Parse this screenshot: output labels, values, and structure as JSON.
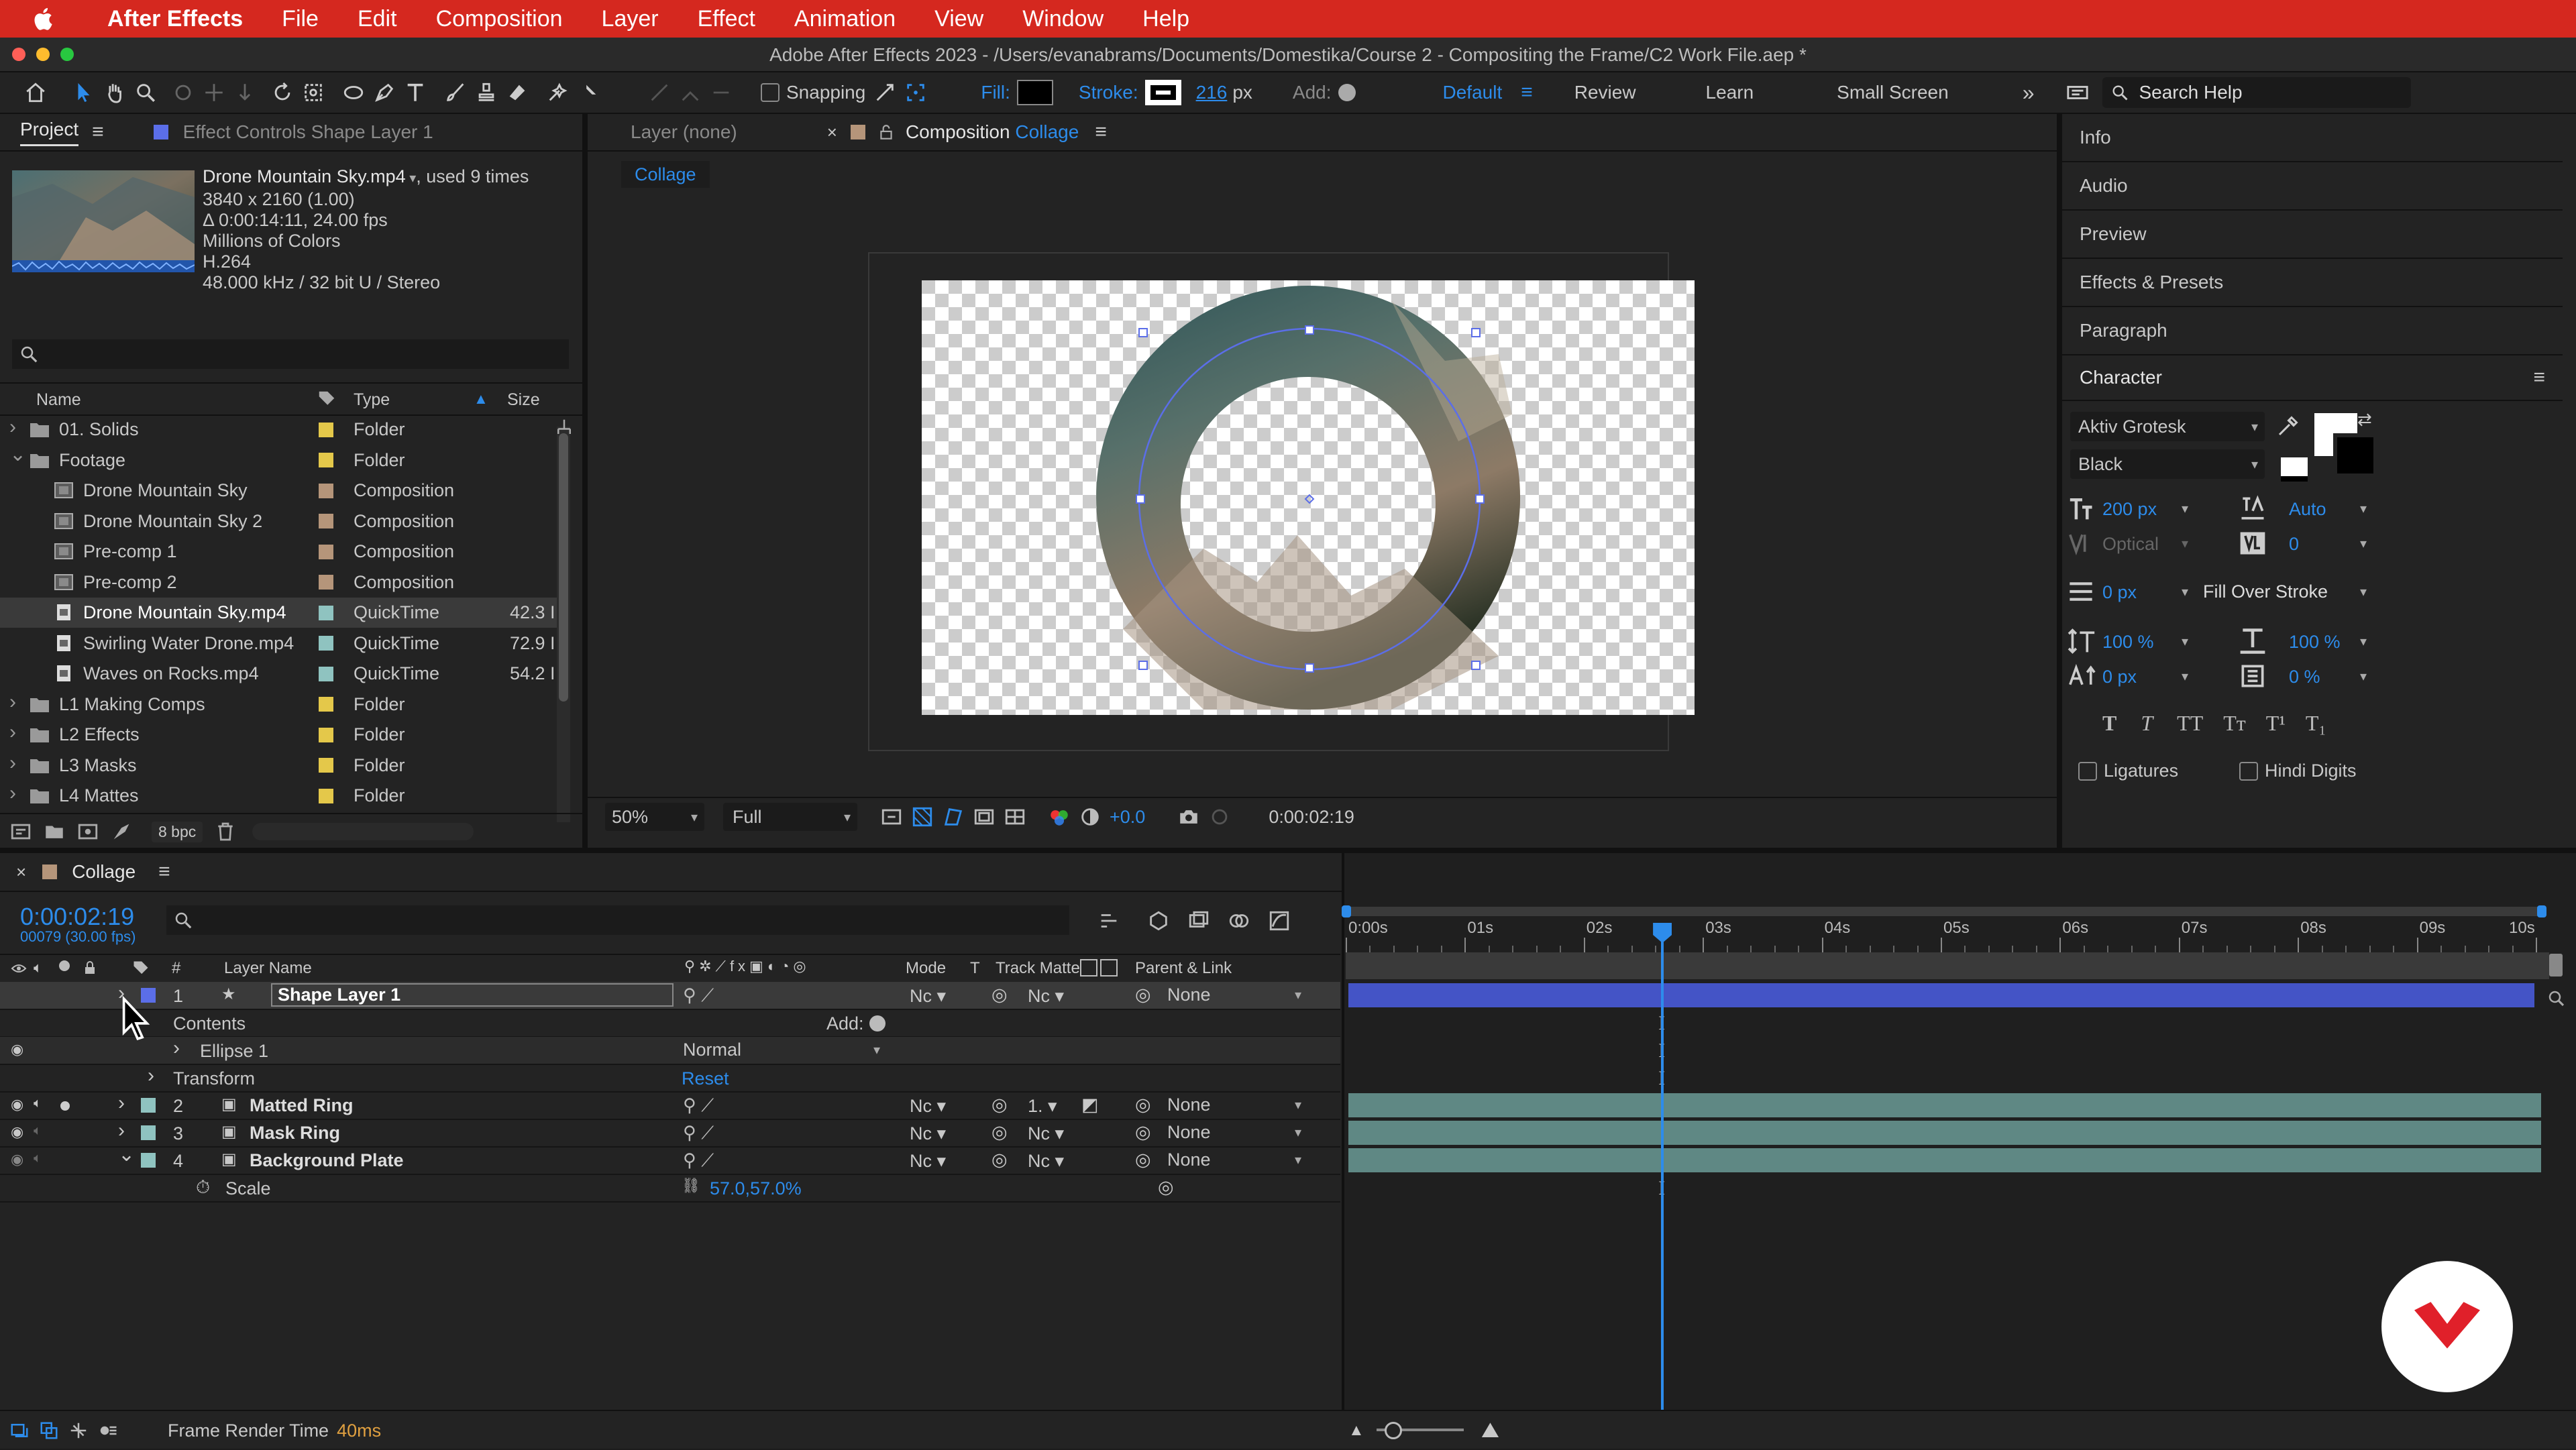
{
  "menubar": {
    "app_name": "After Effects",
    "items": [
      "File",
      "Edit",
      "Composition",
      "Layer",
      "Effect",
      "Animation",
      "View",
      "Window",
      "Help"
    ]
  },
  "window": {
    "title": "Adobe After Effects 2023 - /Users/evanabrams/Documents/Domestika/Course 2 - Compositing the Frame/C2 Work File.aep *"
  },
  "toolbar": {
    "snapping_label": "Snapping",
    "fill_label": "Fill:",
    "stroke_label": "Stroke:",
    "stroke_value": "216",
    "stroke_unit": "px",
    "add_label": "Add:",
    "workspaces": [
      "Default",
      "Review",
      "Learn",
      "Small Screen"
    ],
    "search_placeholder": "Search Help"
  },
  "project": {
    "tab_project": "Project",
    "tab_effect_controls": "Effect Controls Shape Layer 1",
    "selected_name": "Drone Mountain Sky.mp4",
    "used_text": ", used 9 times",
    "info_lines": [
      "3840 x 2160 (1.00)",
      "Δ 0:00:14:11, 24.00 fps",
      "Millions of Colors",
      "H.264",
      "48.000 kHz / 32 bit U / Stereo"
    ],
    "col_name": "Name",
    "col_type": "Type",
    "col_size": "Size",
    "bpc": "8 bpc",
    "rows": [
      {
        "name": "01. Solids",
        "type": "Folder",
        "size": "",
        "kind": "folder",
        "expanded": false,
        "indent": 0,
        "label": "#e4c84a"
      },
      {
        "name": "Footage",
        "type": "Folder",
        "size": "",
        "kind": "folder",
        "expanded": true,
        "indent": 0,
        "label": "#e4c84a"
      },
      {
        "name": "Drone Mountain Sky",
        "type": "Composition",
        "size": "",
        "kind": "comp",
        "indent": 1,
        "label": "#b5957a"
      },
      {
        "name": "Drone Mountain Sky 2",
        "type": "Composition",
        "size": "",
        "kind": "comp",
        "indent": 1,
        "label": "#b5957a"
      },
      {
        "name": "Pre-comp 1",
        "type": "Composition",
        "size": "",
        "kind": "comp",
        "indent": 1,
        "label": "#b5957a"
      },
      {
        "name": "Pre-comp 2",
        "type": "Composition",
        "size": "",
        "kind": "comp",
        "indent": 1,
        "label": "#b5957a"
      },
      {
        "name": "Drone Mountain Sky.mp4",
        "type": "QuickTime",
        "size": "42.3 I",
        "kind": "file",
        "indent": 1,
        "label": "#8fc3c0",
        "selected": true
      },
      {
        "name": "Swirling Water Drone.mp4",
        "type": "QuickTime",
        "size": "72.9 I",
        "kind": "file",
        "indent": 1,
        "label": "#8fc3c0"
      },
      {
        "name": "Waves on Rocks.mp4",
        "type": "QuickTime",
        "size": "54.2 I",
        "kind": "file",
        "indent": 1,
        "label": "#8fc3c0"
      },
      {
        "name": "L1 Making Comps",
        "type": "Folder",
        "size": "",
        "kind": "folder",
        "expanded": false,
        "indent": 0,
        "label": "#e4c84a"
      },
      {
        "name": "L2 Effects",
        "type": "Folder",
        "size": "",
        "kind": "folder",
        "expanded": false,
        "indent": 0,
        "label": "#e4c84a"
      },
      {
        "name": "L3 Masks",
        "type": "Folder",
        "size": "",
        "kind": "folder",
        "expanded": false,
        "indent": 0,
        "label": "#e4c84a"
      },
      {
        "name": "L4 Mattes",
        "type": "Folder",
        "size": "",
        "kind": "folder",
        "expanded": false,
        "indent": 0,
        "label": "#e4c84a"
      }
    ]
  },
  "viewer": {
    "tab_layer": "Layer (none)",
    "tab_comp_prefix": "Composition",
    "tab_comp_name": "Collage",
    "breadcrumb": "Collage",
    "zoom": "50%",
    "resolution": "Full",
    "exposure": "+0.0",
    "timecode": "0:00:02:19"
  },
  "right_panels": [
    "Info",
    "Audio",
    "Preview",
    "Effects & Presets",
    "Paragraph"
  ],
  "character": {
    "title": "Character",
    "font": "Aktiv Grotesk",
    "style": "Black",
    "size": "200 px",
    "leading": "Auto",
    "kerning": "Optical",
    "tracking": "0",
    "stroke_width": "0 px",
    "stroke_mode": "Fill Over Stroke",
    "vscale": "100 %",
    "hscale": "100 %",
    "baseline": "0 px",
    "tsume": "0 %",
    "ligatures": "Ligatures",
    "hindi": "Hindi Digits"
  },
  "timeline": {
    "comp_name": "Collage",
    "timecode": "0:00:02:19",
    "frames": "00079 (30.00 fps)",
    "col_layer_name": "Layer Name",
    "col_mode": "Mode",
    "col_t": "T",
    "col_track_matte": "Track Matte",
    "col_parent": "Parent & Link",
    "ruler": [
      "0:00s",
      "01s",
      "02s",
      "03s",
      "04s",
      "05s",
      "06s",
      "07s",
      "08s",
      "09s",
      "10s"
    ],
    "playhead_fraction": 0.265,
    "layers": [
      {
        "num": "1",
        "name": "Shape Layer 1",
        "mode": "Nc",
        "matte": "Nc",
        "parent": "None",
        "label": "#5b6ee8"
      },
      {
        "num": "2",
        "name": "Matted Ring",
        "mode": "Nc",
        "matte": "1.",
        "parent": "None",
        "label": "#8fc3c0"
      },
      {
        "num": "3",
        "name": "Mask Ring",
        "mode": "Nc",
        "matte": "Nc",
        "parent": "None",
        "label": "#8fc3c0"
      },
      {
        "num": "4",
        "name": "Background Plate",
        "mode": "Nc",
        "matte": "Nc",
        "parent": "None",
        "label": "#8fc3c0"
      }
    ],
    "contents_label": "Contents",
    "add_label": "Add:",
    "ellipse_label": "Ellipse 1",
    "ellipse_mode": "Normal",
    "transform_label": "Transform",
    "reset_label": "Reset",
    "scale_label": "Scale",
    "scale_value": "57.0,57.0%",
    "render_label": "Frame Render Time",
    "render_value": "40ms"
  }
}
